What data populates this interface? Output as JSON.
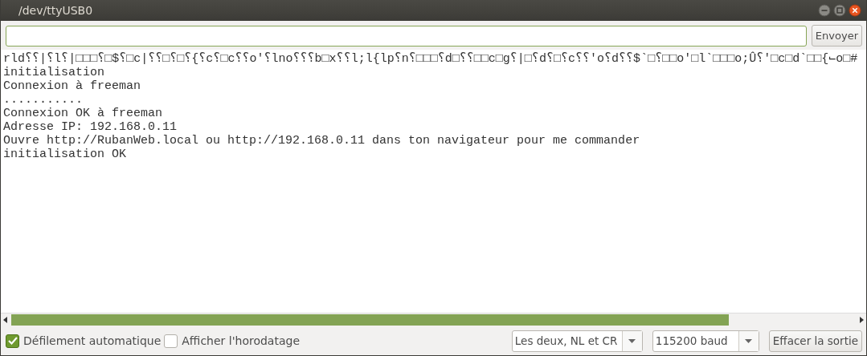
{
  "window": {
    "title": "/dev/ttyUSB0"
  },
  "send_button": {
    "label": "Envoyer"
  },
  "output_lines": [
    "rld⸮⸮|⸮l⸮|□□□⸮□$⸮□c|⸮⸮□⸮□⸮{⸮c⸮□c⸮⸮o'⸮lno⸮⸮⸮b□x⸮⸮l;l{lp⸮n⸮□□□⸮d□⸮⸮□□c□g⸮|□⸮d⸮□⸮c⸮⸮'o⸮d⸮⸮$`□⸮□□o'□l`□□□o;Û⸮'□c□d`□□{⌙o□#",
    "initialisation",
    "Connexion à freeman",
    "...........",
    "Connexion OK à freeman",
    "Adresse IP: 192.168.0.11",
    "Ouvre http://RubanWeb.local ou http://192.168.0.11 dans ton navigateur pour me commander",
    "initialisation OK"
  ],
  "options": [
    {
      "label": "Défilement automatique",
      "checked": true
    },
    {
      "label": "Afficher l'horodatage",
      "checked": false
    }
  ],
  "line_ending_select": {
    "value": "Les deux, NL et CR"
  },
  "baud_select": {
    "value": "115200 baud"
  },
  "clear_button": {
    "label": "Effacer la sortie"
  }
}
